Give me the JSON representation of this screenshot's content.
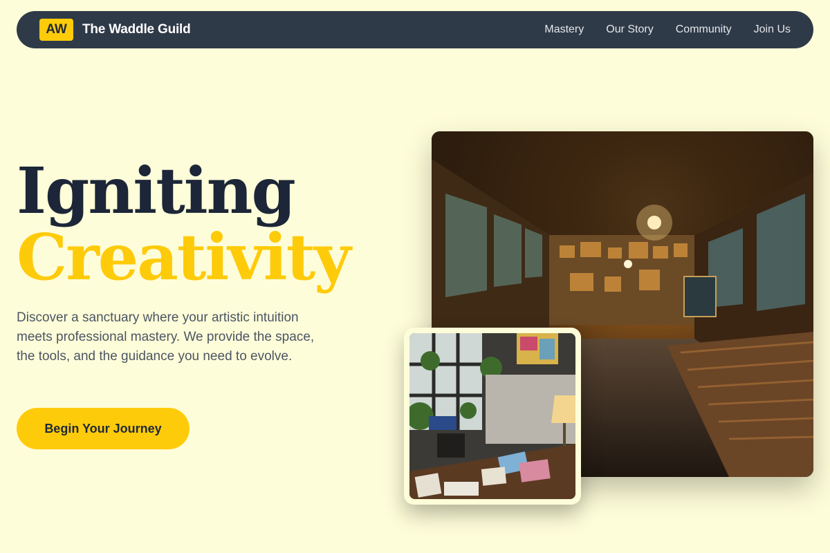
{
  "nav": {
    "logo_text": "AW",
    "brand_name": "The Waddle Guild",
    "links": [
      "Mastery",
      "Our Story",
      "Community",
      "Join Us"
    ]
  },
  "hero": {
    "title_line1": "Igniting",
    "title_line2": "Creativity",
    "description": "Discover a sanctuary where your artistic intuition meets professional mastery. We provide the space, the tools, and the guidance you need to evolve.",
    "cta_label": "Begin Your Journey"
  },
  "colors": {
    "background": "#fefdd9",
    "nav_bg": "#2f3a48",
    "accent": "#fecb0a",
    "heading_dark": "#1c2638",
    "body_text": "#4b5563"
  },
  "images": {
    "main_photo": "art-gallery-corridor-photo",
    "small_photo": "art-studio-desk-photo"
  }
}
